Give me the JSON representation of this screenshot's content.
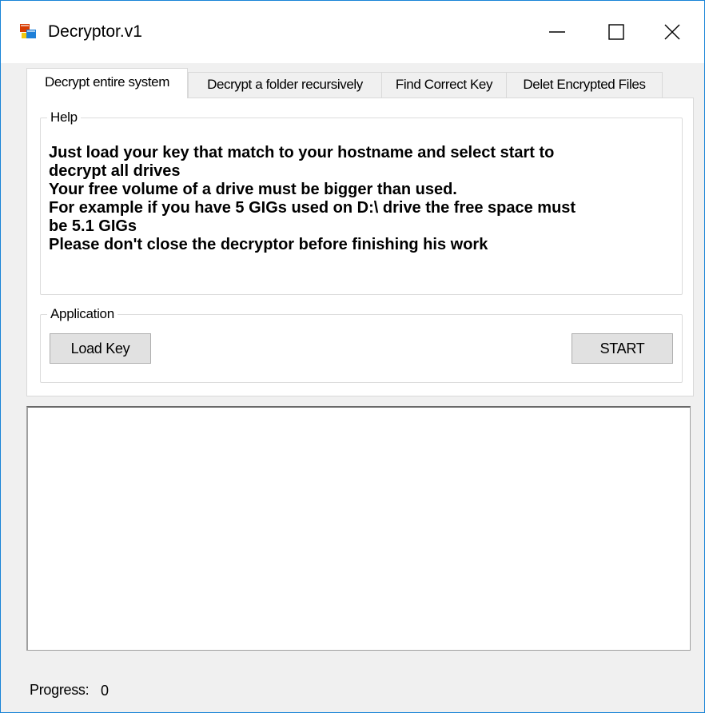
{
  "window": {
    "title": "Decryptor.v1",
    "icon": "app-window-icon"
  },
  "tabs": [
    {
      "label": "Decrypt entire system",
      "active": true
    },
    {
      "label": "Decrypt a folder recursively",
      "active": false
    },
    {
      "label": "Find Correct Key",
      "active": false
    },
    {
      "label": "Delet Encrypted Files",
      "active": false
    }
  ],
  "help": {
    "legend": "Help",
    "lines": [
      "Just load your key that match to your hostname and select start to",
      "decrypt all drives",
      "Your free volume of a drive must be bigger than used.",
      "For example if you have 5 GIGs used on D:\\ drive the free space must",
      "be 5.1 GIGs",
      "Please don't close the decryptor before finishing his work"
    ]
  },
  "application": {
    "legend": "Application",
    "load_key_label": "Load Key",
    "start_label": "START"
  },
  "log": {
    "content": ""
  },
  "progress": {
    "label": "Progress:",
    "value": "0"
  }
}
